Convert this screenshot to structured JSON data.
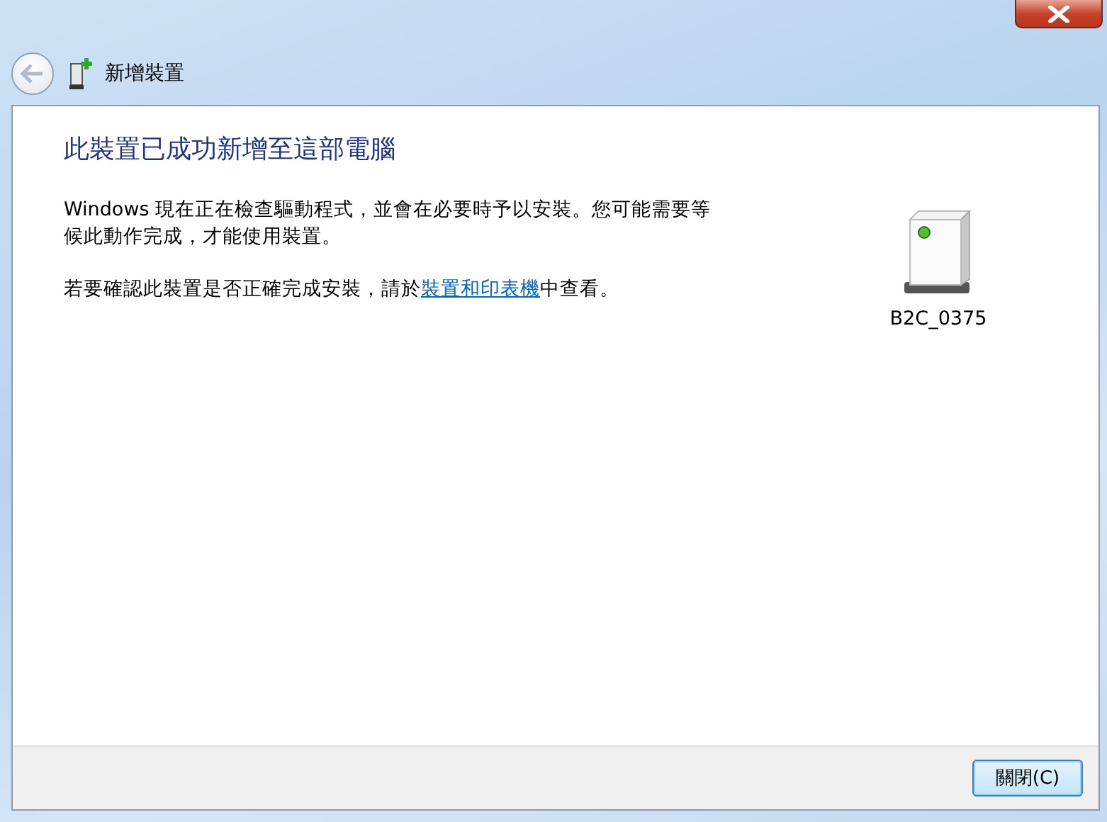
{
  "header": {
    "title": "新增裝置"
  },
  "content": {
    "heading": "此裝置已成功新增至這部電腦",
    "paragraph": "Windows 現在正在檢查驅動程式，並會在必要時予以安裝。您可能需要等候此動作完成，才能使用裝置。",
    "confirm": {
      "before": "若要確認此裝置是否正確完成安裝，請於",
      "link": "裝置和印表機",
      "after": "中查看。"
    },
    "device": {
      "name": "B2C_0375"
    }
  },
  "buttons": [
    {
      "label": "關閉(C)",
      "kind": "default"
    }
  ]
}
